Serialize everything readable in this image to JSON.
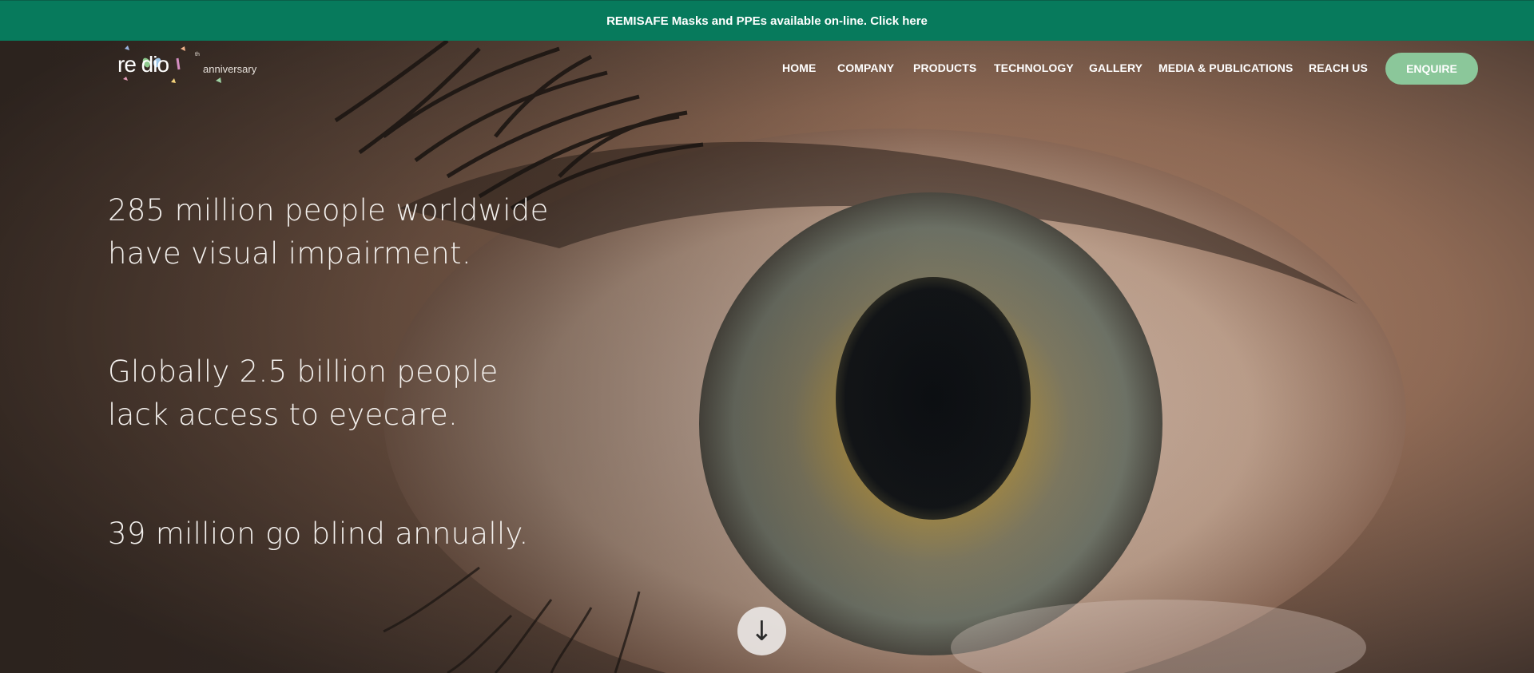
{
  "announcement": {
    "text": "REMISAFE Masks and PPEs available on-line. Click here"
  },
  "logo": {
    "wordmark": "re dio",
    "superscript": "th",
    "tagline": "anniversary"
  },
  "nav": {
    "items": [
      {
        "label": "HOME"
      },
      {
        "label": "COMPANY"
      },
      {
        "label": "PRODUCTS"
      },
      {
        "label": "TECHNOLOGY"
      },
      {
        "label": "GALLERY"
      },
      {
        "label": "MEDIA & PUBLICATIONS"
      },
      {
        "label": "REACH US"
      }
    ],
    "cta_label": "ENQUIRE"
  },
  "hero": {
    "stats": [
      {
        "line1": "285 million people worldwide",
        "line2": "have visual impairment."
      },
      {
        "line1": "Globally 2.5 billion people",
        "line2": "lack access to eyecare."
      },
      {
        "line1": "39 million go blind annually.",
        "line2": ""
      }
    ],
    "scroll_icon": "arrow-down-icon",
    "scroll_glyph": "↓"
  },
  "colors": {
    "announcement_bg": "#077a5c",
    "cta_bg": "#8bc79a",
    "text": "#ffffff"
  }
}
